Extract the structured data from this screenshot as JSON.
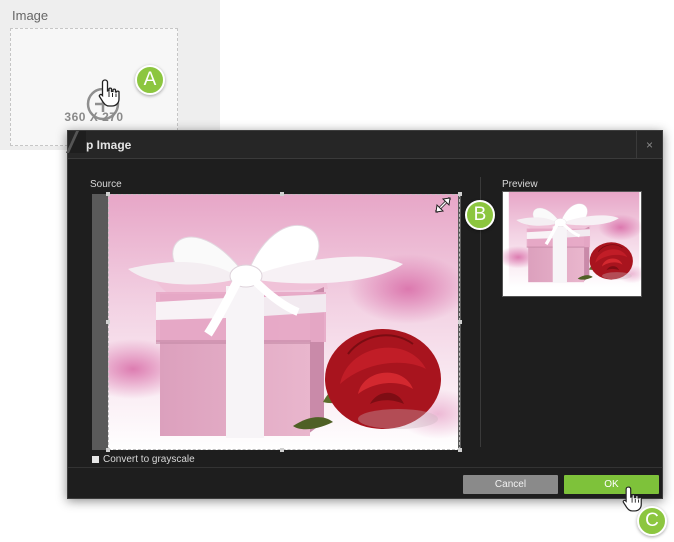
{
  "upload": {
    "label": "Image",
    "size_text": "360 X 270"
  },
  "callouts": {
    "a": "A",
    "b": "B",
    "c": "C"
  },
  "dialog": {
    "title": "rop Image",
    "close_glyph": "×",
    "source_label": "Source",
    "preview_label": "Preview",
    "grayscale_label": "Convert to grayscale",
    "grayscale_checked": false,
    "cancel_label": "Cancel",
    "ok_label": "OK"
  },
  "image_subject": "pink gift box with white ribbon and red rose",
  "colors": {
    "accent_green": "#8cc63f",
    "ok_button": "#7ec23a",
    "cancel_button": "#8a8a8a",
    "dialog_bg": "#1e1e1e",
    "gift_pink": "#e8a9c6"
  },
  "icons": {
    "upload": "plus-circle-icon",
    "cursor": "hand-pointer-icon",
    "resize": "diagonal-resize-icon",
    "close": "close-icon"
  }
}
